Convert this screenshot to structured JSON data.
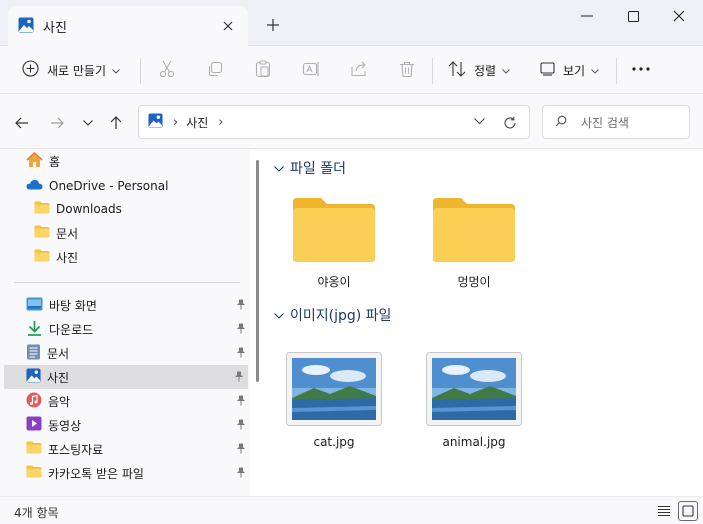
{
  "window": {
    "tab_title": "사진"
  },
  "commands": {
    "new_label": "새로 만들기",
    "sort_label": "정렬",
    "view_label": "보기"
  },
  "address": {
    "crumb": "사진",
    "search_placeholder": "사진 검색"
  },
  "sidebar": {
    "top_items": [
      {
        "label": "홈",
        "icon": "home-icon"
      },
      {
        "label": "OneDrive - Personal",
        "icon": "onedrive-cloud-icon"
      },
      {
        "label": "Downloads",
        "icon": "folder-icon"
      },
      {
        "label": "문서",
        "icon": "folder-icon"
      },
      {
        "label": "사진",
        "icon": "folder-icon"
      }
    ],
    "quick_items": [
      {
        "label": "바탕 화면",
        "icon": "desktop-icon"
      },
      {
        "label": "다운로드",
        "icon": "download-icon"
      },
      {
        "label": "문서",
        "icon": "document-icon"
      },
      {
        "label": "사진",
        "icon": "pictures-icon"
      },
      {
        "label": "음악",
        "icon": "music-icon"
      },
      {
        "label": "동영상",
        "icon": "video-icon"
      },
      {
        "label": "포스팅자료",
        "icon": "folder-icon"
      },
      {
        "label": "카카오톡 받은 파일",
        "icon": "folder-icon"
      }
    ],
    "selected": "사진"
  },
  "groups": [
    {
      "title": "파일 폴더",
      "items": [
        "야옹이",
        "멍멍이"
      ]
    },
    {
      "title": "이미지(jpg) 파일",
      "items": [
        "cat.jpg",
        "animal.jpg"
      ]
    }
  ],
  "status": {
    "count": "4개 항목"
  },
  "colors": {
    "folder": "#f6c342",
    "accent": "#1d63c2",
    "group_header": "#1d3a6b"
  }
}
